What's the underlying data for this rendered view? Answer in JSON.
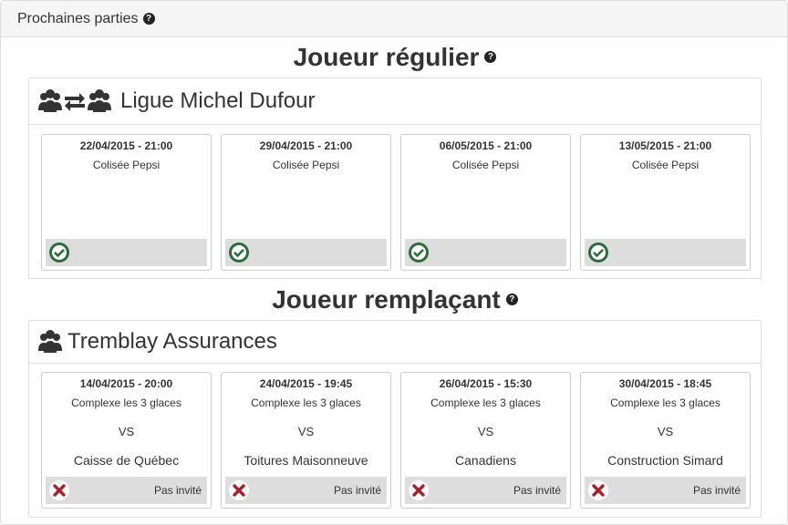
{
  "header": {
    "title": "Prochaines parties",
    "help": "?"
  },
  "regular": {
    "title": "Joueur régulier",
    "help": "?",
    "league_name": "Ligue Michel Dufour",
    "games": [
      {
        "date": "22/04/2015 - 21:00",
        "place": "Colisée Pepsi",
        "status": "confirmed"
      },
      {
        "date": "29/04/2015 - 21:00",
        "place": "Colisée Pepsi",
        "status": "confirmed"
      },
      {
        "date": "06/05/2015 - 21:00",
        "place": "Colisée Pepsi",
        "status": "confirmed"
      },
      {
        "date": "13/05/2015 - 21:00",
        "place": "Colisée Pepsi",
        "status": "confirmed"
      }
    ]
  },
  "substitute": {
    "title": "Joueur remplaçant",
    "help": "?",
    "team_name": "Tremblay Assurances",
    "vs_label": "VS",
    "games": [
      {
        "date": "14/04/2015 - 20:00",
        "place": "Complexe les 3 glaces",
        "opponent": "Caisse de Québec",
        "status_text": "Pas invité"
      },
      {
        "date": "24/04/2015 - 19:45",
        "place": "Complexe les 3 glaces",
        "opponent": "Toitures Maisonneuve",
        "status_text": "Pas invité"
      },
      {
        "date": "26/04/2015 - 15:30",
        "place": "Complexe les 3 glaces",
        "opponent": "Canadiens",
        "status_text": "Pas invité"
      },
      {
        "date": "30/04/2015 - 18:45",
        "place": "Complexe les 3 glaces",
        "opponent": "Construction Simard",
        "status_text": "Pas invité"
      }
    ]
  },
  "colors": {
    "confirmed": "#2e6b3a",
    "declined": "#a8202a",
    "status_bar": "#dddddd"
  },
  "icons": {
    "help": "question-circle-icon",
    "regular_league": "users-exchange-icon",
    "substitute_team": "users-icon",
    "confirmed": "check-circle-icon",
    "declined": "times-circle-icon"
  }
}
